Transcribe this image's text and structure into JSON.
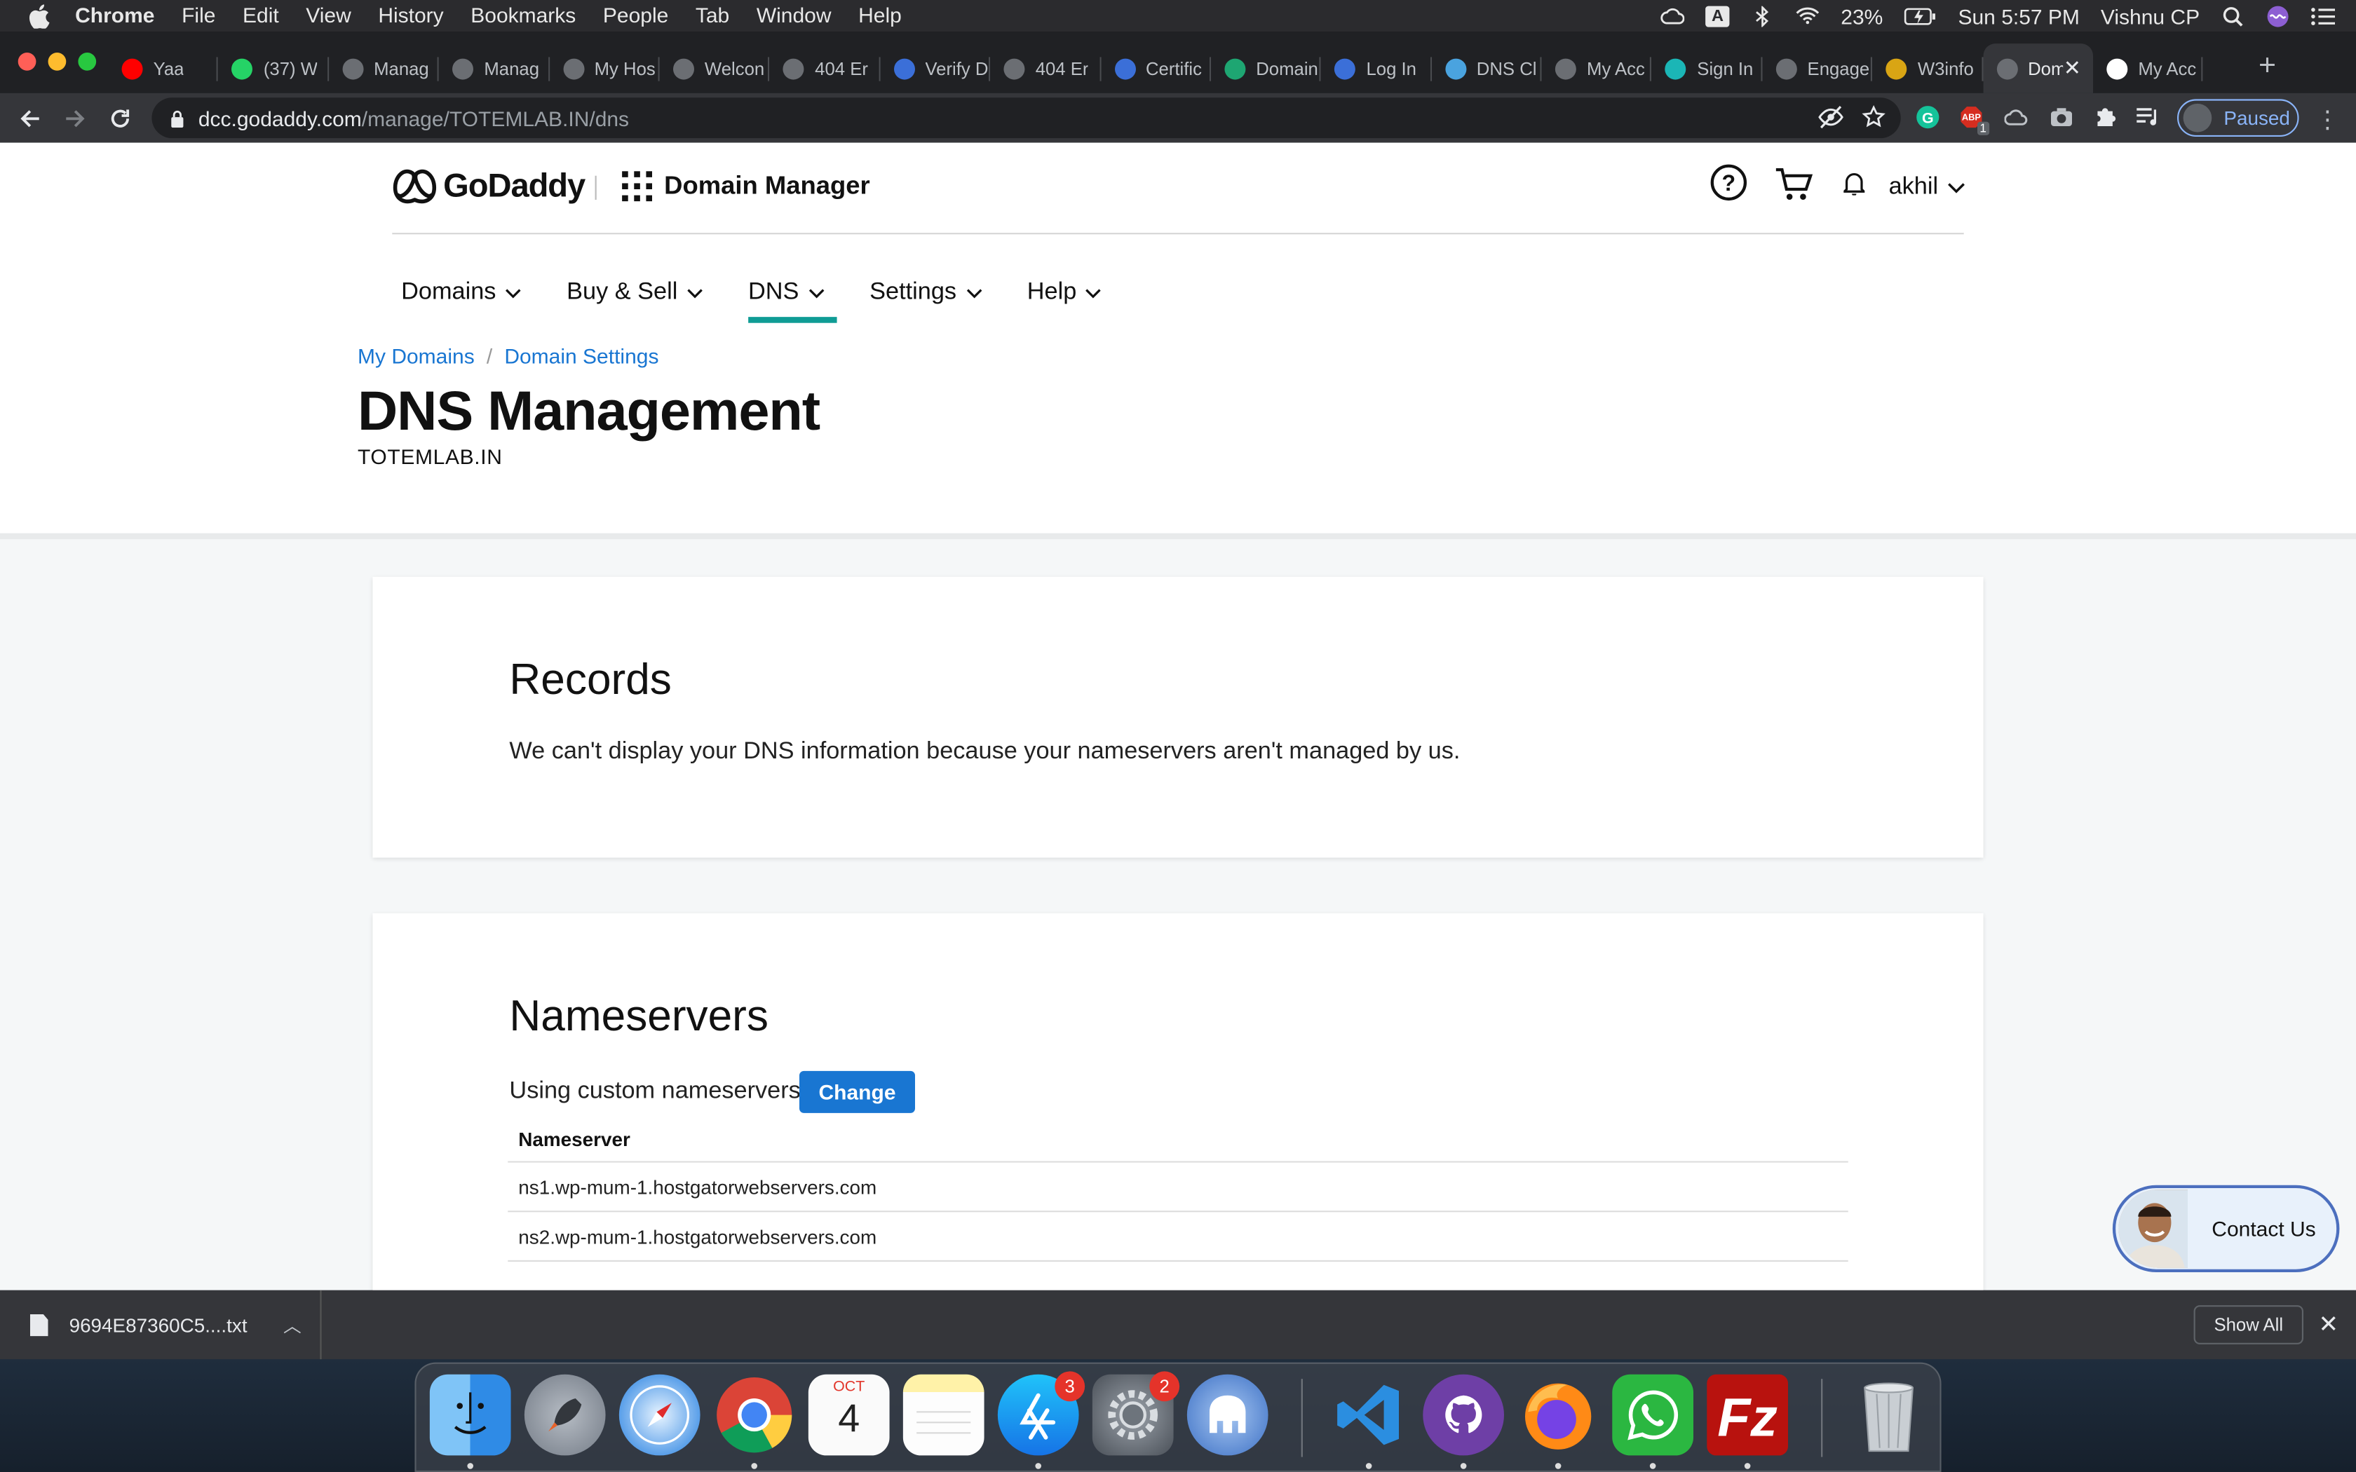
{
  "menubar": {
    "app": "Chrome",
    "items": [
      "File",
      "Edit",
      "View",
      "History",
      "Bookmarks",
      "People",
      "Tab",
      "Window",
      "Help"
    ],
    "battery": "23%",
    "clock": "Sun 5:57 PM",
    "user": "Vishnu CP",
    "input_source": "A"
  },
  "tabs": [
    {
      "label": "Yaa",
      "color": "#ff0000"
    },
    {
      "label": "(37) W",
      "color": "#25d366"
    },
    {
      "label": "Manag",
      "color": "#6b6e73"
    },
    {
      "label": "Manag",
      "color": "#6b6e73"
    },
    {
      "label": "My Hos",
      "color": "#6b6e73"
    },
    {
      "label": "Welcon",
      "color": "#6b6e73"
    },
    {
      "label": "404 Er",
      "color": "#6b6e73"
    },
    {
      "label": "Verify D",
      "color": "#3b6fd8"
    },
    {
      "label": "404 Er",
      "color": "#6b6e73"
    },
    {
      "label": "Certific",
      "color": "#3b6fd8"
    },
    {
      "label": "Domain",
      "color": "#1ea672"
    },
    {
      "label": "Log In",
      "color": "#3b6fd8"
    },
    {
      "label": "DNS Cl",
      "color": "#4aa3df"
    },
    {
      "label": "My Acc",
      "color": "#6b6e73"
    },
    {
      "label": "Sign In",
      "color": "#1bb6b6"
    },
    {
      "label": "Engage",
      "color": "#6b6e73"
    },
    {
      "label": "W3info",
      "color": "#d9a514"
    },
    {
      "label": "Dom",
      "color": "#6b6e73",
      "active": true
    },
    {
      "label": "My Acc",
      "color": "#ffffff"
    }
  ],
  "address": {
    "host": "dcc.godaddy.com",
    "path": "/manage/TOTEMLAB.IN/dns"
  },
  "profile": {
    "label": "Paused"
  },
  "extensions": {
    "abp_badge": "1"
  },
  "site": {
    "brand": "GoDaddy",
    "product": "Domain Manager",
    "user": "akhil",
    "nav": [
      "Domains",
      "Buy & Sell",
      "DNS",
      "Settings",
      "Help"
    ],
    "active_nav": "DNS",
    "breadcrumb": [
      "My Domains",
      "Domain Settings"
    ],
    "breadcrumb_sep": "/",
    "title": "DNS Management",
    "domain": "TOTEMLAB.IN"
  },
  "records": {
    "heading": "Records",
    "message": "We can't display your DNS information because your nameservers aren't managed by us."
  },
  "nameservers": {
    "heading": "Nameservers",
    "status": "Using custom nameservers",
    "change_label": "Change",
    "column": "Nameserver",
    "rows": [
      "ns1.wp-mum-1.hostgatorwebservers.com",
      "ns2.wp-mum-1.hostgatorwebservers.com"
    ]
  },
  "contact": {
    "label": "Contact Us"
  },
  "downloads": {
    "file": "9694E87360C5....txt",
    "show_all": "Show All"
  },
  "dock": {
    "calendar_month": "OCT",
    "calendar_day": "4",
    "appstore_badge": "3",
    "prefs_badge": "2"
  },
  "colors": {
    "link": "#1976d2",
    "primary_button": "#1976d2",
    "nav_underline": "#0f9c95",
    "chrome_dark": "#202124",
    "chrome_toolbar": "#35363a"
  }
}
